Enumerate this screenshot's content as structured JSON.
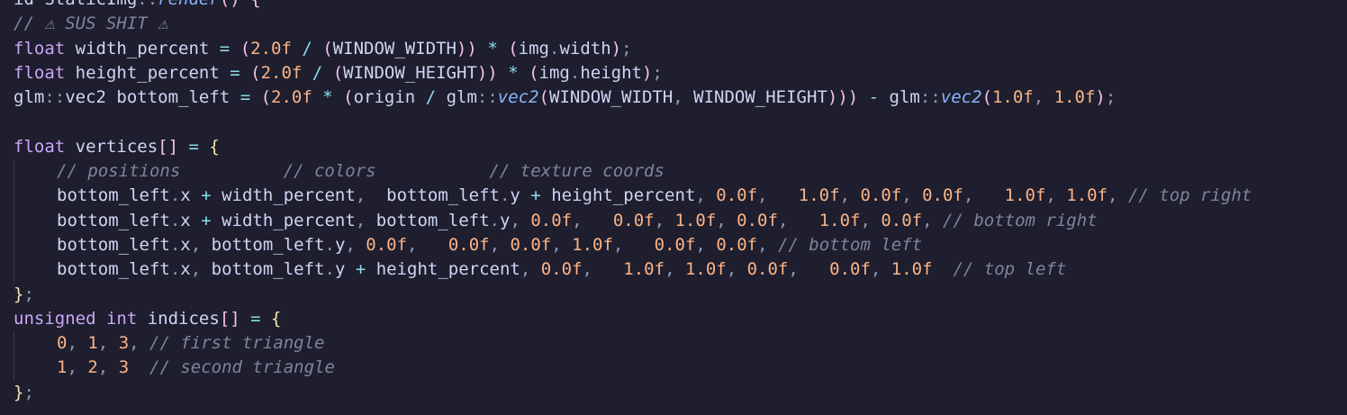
{
  "editor": {
    "language": "cpp",
    "colors": {
      "background": "#1e1e2e",
      "text": "#cdd6f4",
      "keyword": "#cba6f7",
      "number": "#fab387",
      "operator": "#89dceb",
      "punct": "#9399b2",
      "brace": "#f9e2af",
      "paren": "#f5c2e7",
      "comment": "#7f849c",
      "function": "#89b4fa",
      "guide": "#3b3d52"
    },
    "lines": [
      {
        "indent": false,
        "guide": false,
        "tokens": [
          {
            "t": "id StaticImg",
            "c": "text"
          },
          {
            "t": "::",
            "c": "punct"
          },
          {
            "t": "render",
            "c": "function",
            "i": true
          },
          {
            "t": "() {",
            "c": "paren"
          }
        ]
      },
      {
        "indent": false,
        "guide": false,
        "tokens": [
          {
            "t": "// ⚠ SUS SHIT ⚠",
            "c": "comment",
            "i": true
          }
        ]
      },
      {
        "indent": false,
        "guide": false,
        "tokens": [
          {
            "t": "float",
            "c": "keyword"
          },
          {
            "t": " width_percent ",
            "c": "text"
          },
          {
            "t": "=",
            "c": "operator"
          },
          {
            "t": " ",
            "c": "text"
          },
          {
            "t": "(",
            "c": "paren"
          },
          {
            "t": "2.0f",
            "c": "number"
          },
          {
            "t": " / ",
            "c": "operator"
          },
          {
            "t": "(",
            "c": "paren"
          },
          {
            "t": "WINDOW_WIDTH",
            "c": "text"
          },
          {
            "t": "))",
            "c": "paren"
          },
          {
            "t": " * ",
            "c": "operator"
          },
          {
            "t": "(",
            "c": "paren"
          },
          {
            "t": "img",
            "c": "text"
          },
          {
            "t": ".",
            "c": "punct"
          },
          {
            "t": "width",
            "c": "text"
          },
          {
            "t": ")",
            "c": "paren"
          },
          {
            "t": ";",
            "c": "punct"
          }
        ]
      },
      {
        "indent": false,
        "guide": false,
        "tokens": [
          {
            "t": "float",
            "c": "keyword"
          },
          {
            "t": " height_percent ",
            "c": "text"
          },
          {
            "t": "=",
            "c": "operator"
          },
          {
            "t": " ",
            "c": "text"
          },
          {
            "t": "(",
            "c": "paren"
          },
          {
            "t": "2.0f",
            "c": "number"
          },
          {
            "t": " / ",
            "c": "operator"
          },
          {
            "t": "(",
            "c": "paren"
          },
          {
            "t": "WINDOW_HEIGHT",
            "c": "text"
          },
          {
            "t": "))",
            "c": "paren"
          },
          {
            "t": " * ",
            "c": "operator"
          },
          {
            "t": "(",
            "c": "paren"
          },
          {
            "t": "img",
            "c": "text"
          },
          {
            "t": ".",
            "c": "punct"
          },
          {
            "t": "height",
            "c": "text"
          },
          {
            "t": ")",
            "c": "paren"
          },
          {
            "t": ";",
            "c": "punct"
          }
        ]
      },
      {
        "indent": false,
        "guide": false,
        "tokens": [
          {
            "t": "glm",
            "c": "text"
          },
          {
            "t": "::",
            "c": "punct"
          },
          {
            "t": "vec2 bottom_left ",
            "c": "text"
          },
          {
            "t": "=",
            "c": "operator"
          },
          {
            "t": " ",
            "c": "text"
          },
          {
            "t": "(",
            "c": "paren"
          },
          {
            "t": "2.0f",
            "c": "number"
          },
          {
            "t": " * ",
            "c": "operator"
          },
          {
            "t": "(",
            "c": "paren"
          },
          {
            "t": "origin",
            "c": "text"
          },
          {
            "t": " / ",
            "c": "operator"
          },
          {
            "t": "glm",
            "c": "text"
          },
          {
            "t": "::",
            "c": "punct"
          },
          {
            "t": "vec2",
            "c": "function",
            "i": true
          },
          {
            "t": "(",
            "c": "paren"
          },
          {
            "t": "WINDOW_WIDTH",
            "c": "text"
          },
          {
            "t": ", ",
            "c": "punct"
          },
          {
            "t": "WINDOW_HEIGHT",
            "c": "text"
          },
          {
            "t": ")))",
            "c": "paren"
          },
          {
            "t": " - ",
            "c": "operator"
          },
          {
            "t": "glm",
            "c": "text"
          },
          {
            "t": "::",
            "c": "punct"
          },
          {
            "t": "vec2",
            "c": "function",
            "i": true
          },
          {
            "t": "(",
            "c": "paren"
          },
          {
            "t": "1.0f",
            "c": "number"
          },
          {
            "t": ", ",
            "c": "punct"
          },
          {
            "t": "1.0f",
            "c": "number"
          },
          {
            "t": ")",
            "c": "paren"
          },
          {
            "t": ";",
            "c": "punct"
          }
        ]
      },
      {
        "indent": false,
        "guide": false,
        "tokens": []
      },
      {
        "indent": false,
        "guide": false,
        "tokens": [
          {
            "t": "float",
            "c": "keyword"
          },
          {
            "t": " vertices",
            "c": "text"
          },
          {
            "t": "[]",
            "c": "paren"
          },
          {
            "t": " = ",
            "c": "operator"
          },
          {
            "t": "{",
            "c": "brace"
          }
        ]
      },
      {
        "indent": true,
        "guide": true,
        "tokens": [
          {
            "t": "// positions          // colors           // texture coords",
            "c": "comment",
            "i": true
          }
        ]
      },
      {
        "indent": true,
        "guide": true,
        "tokens": [
          {
            "t": "bottom_left",
            "c": "text"
          },
          {
            "t": ".",
            "c": "punct"
          },
          {
            "t": "x",
            "c": "text"
          },
          {
            "t": " + ",
            "c": "operator"
          },
          {
            "t": "width_percent",
            "c": "text"
          },
          {
            "t": ",  ",
            "c": "punct"
          },
          {
            "t": "bottom_left",
            "c": "text"
          },
          {
            "t": ".",
            "c": "punct"
          },
          {
            "t": "y",
            "c": "text"
          },
          {
            "t": " + ",
            "c": "operator"
          },
          {
            "t": "height_percent",
            "c": "text"
          },
          {
            "t": ", ",
            "c": "punct"
          },
          {
            "t": "0.0f",
            "c": "number"
          },
          {
            "t": ",   ",
            "c": "punct"
          },
          {
            "t": "1.0f",
            "c": "number"
          },
          {
            "t": ", ",
            "c": "punct"
          },
          {
            "t": "0.0f",
            "c": "number"
          },
          {
            "t": ", ",
            "c": "punct"
          },
          {
            "t": "0.0f",
            "c": "number"
          },
          {
            "t": ",   ",
            "c": "punct"
          },
          {
            "t": "1.0f",
            "c": "number"
          },
          {
            "t": ", ",
            "c": "punct"
          },
          {
            "t": "1.0f",
            "c": "number"
          },
          {
            "t": ", ",
            "c": "punct"
          },
          {
            "t": "// top right",
            "c": "comment",
            "i": true
          }
        ]
      },
      {
        "indent": true,
        "guide": true,
        "tokens": [
          {
            "t": "bottom_left",
            "c": "text"
          },
          {
            "t": ".",
            "c": "punct"
          },
          {
            "t": "x",
            "c": "text"
          },
          {
            "t": " + ",
            "c": "operator"
          },
          {
            "t": "width_percent",
            "c": "text"
          },
          {
            "t": ", ",
            "c": "punct"
          },
          {
            "t": "bottom_left",
            "c": "text"
          },
          {
            "t": ".",
            "c": "punct"
          },
          {
            "t": "y",
            "c": "text"
          },
          {
            "t": ", ",
            "c": "punct"
          },
          {
            "t": "0.0f",
            "c": "number"
          },
          {
            "t": ",   ",
            "c": "punct"
          },
          {
            "t": "0.0f",
            "c": "number"
          },
          {
            "t": ", ",
            "c": "punct"
          },
          {
            "t": "1.0f",
            "c": "number"
          },
          {
            "t": ", ",
            "c": "punct"
          },
          {
            "t": "0.0f",
            "c": "number"
          },
          {
            "t": ",   ",
            "c": "punct"
          },
          {
            "t": "1.0f",
            "c": "number"
          },
          {
            "t": ", ",
            "c": "punct"
          },
          {
            "t": "0.0f",
            "c": "number"
          },
          {
            "t": ", ",
            "c": "punct"
          },
          {
            "t": "// bottom right",
            "c": "comment",
            "i": true
          }
        ]
      },
      {
        "indent": true,
        "guide": true,
        "tokens": [
          {
            "t": "bottom_left",
            "c": "text"
          },
          {
            "t": ".",
            "c": "punct"
          },
          {
            "t": "x",
            "c": "text"
          },
          {
            "t": ", ",
            "c": "punct"
          },
          {
            "t": "bottom_left",
            "c": "text"
          },
          {
            "t": ".",
            "c": "punct"
          },
          {
            "t": "y",
            "c": "text"
          },
          {
            "t": ", ",
            "c": "punct"
          },
          {
            "t": "0.0f",
            "c": "number"
          },
          {
            "t": ",   ",
            "c": "punct"
          },
          {
            "t": "0.0f",
            "c": "number"
          },
          {
            "t": ", ",
            "c": "punct"
          },
          {
            "t": "0.0f",
            "c": "number"
          },
          {
            "t": ", ",
            "c": "punct"
          },
          {
            "t": "1.0f",
            "c": "number"
          },
          {
            "t": ",   ",
            "c": "punct"
          },
          {
            "t": "0.0f",
            "c": "number"
          },
          {
            "t": ", ",
            "c": "punct"
          },
          {
            "t": "0.0f",
            "c": "number"
          },
          {
            "t": ", ",
            "c": "punct"
          },
          {
            "t": "// bottom left",
            "c": "comment",
            "i": true
          }
        ]
      },
      {
        "indent": true,
        "guide": true,
        "tokens": [
          {
            "t": "bottom_left",
            "c": "text"
          },
          {
            "t": ".",
            "c": "punct"
          },
          {
            "t": "x",
            "c": "text"
          },
          {
            "t": ", ",
            "c": "punct"
          },
          {
            "t": "bottom_left",
            "c": "text"
          },
          {
            "t": ".",
            "c": "punct"
          },
          {
            "t": "y",
            "c": "text"
          },
          {
            "t": " + ",
            "c": "operator"
          },
          {
            "t": "height_percent",
            "c": "text"
          },
          {
            "t": ", ",
            "c": "punct"
          },
          {
            "t": "0.0f",
            "c": "number"
          },
          {
            "t": ",   ",
            "c": "punct"
          },
          {
            "t": "1.0f",
            "c": "number"
          },
          {
            "t": ", ",
            "c": "punct"
          },
          {
            "t": "1.0f",
            "c": "number"
          },
          {
            "t": ", ",
            "c": "punct"
          },
          {
            "t": "0.0f",
            "c": "number"
          },
          {
            "t": ",   ",
            "c": "punct"
          },
          {
            "t": "0.0f",
            "c": "number"
          },
          {
            "t": ", ",
            "c": "punct"
          },
          {
            "t": "1.0f",
            "c": "number"
          },
          {
            "t": "  ",
            "c": "punct"
          },
          {
            "t": "// top left",
            "c": "comment",
            "i": true
          }
        ]
      },
      {
        "indent": false,
        "guide": false,
        "tokens": [
          {
            "t": "}",
            "c": "brace"
          },
          {
            "t": ";",
            "c": "punct"
          }
        ]
      },
      {
        "indent": false,
        "guide": false,
        "tokens": [
          {
            "t": "unsigned",
            "c": "keyword"
          },
          {
            "t": " ",
            "c": "text"
          },
          {
            "t": "int",
            "c": "keyword"
          },
          {
            "t": " indices",
            "c": "text"
          },
          {
            "t": "[]",
            "c": "paren"
          },
          {
            "t": " = ",
            "c": "operator"
          },
          {
            "t": "{",
            "c": "brace"
          }
        ]
      },
      {
        "indent": true,
        "guide": true,
        "tokens": [
          {
            "t": "0",
            "c": "number"
          },
          {
            "t": ", ",
            "c": "punct"
          },
          {
            "t": "1",
            "c": "number"
          },
          {
            "t": ", ",
            "c": "punct"
          },
          {
            "t": "3",
            "c": "number"
          },
          {
            "t": ", ",
            "c": "punct"
          },
          {
            "t": "// first triangle",
            "c": "comment",
            "i": true
          }
        ]
      },
      {
        "indent": true,
        "guide": true,
        "tokens": [
          {
            "t": "1",
            "c": "number"
          },
          {
            "t": ", ",
            "c": "punct"
          },
          {
            "t": "2",
            "c": "number"
          },
          {
            "t": ", ",
            "c": "punct"
          },
          {
            "t": "3",
            "c": "number"
          },
          {
            "t": "  ",
            "c": "punct"
          },
          {
            "t": "// second triangle",
            "c": "comment",
            "i": true
          }
        ]
      },
      {
        "indent": false,
        "guide": false,
        "tokens": [
          {
            "t": "}",
            "c": "brace"
          },
          {
            "t": ";",
            "c": "punct"
          }
        ]
      }
    ]
  }
}
